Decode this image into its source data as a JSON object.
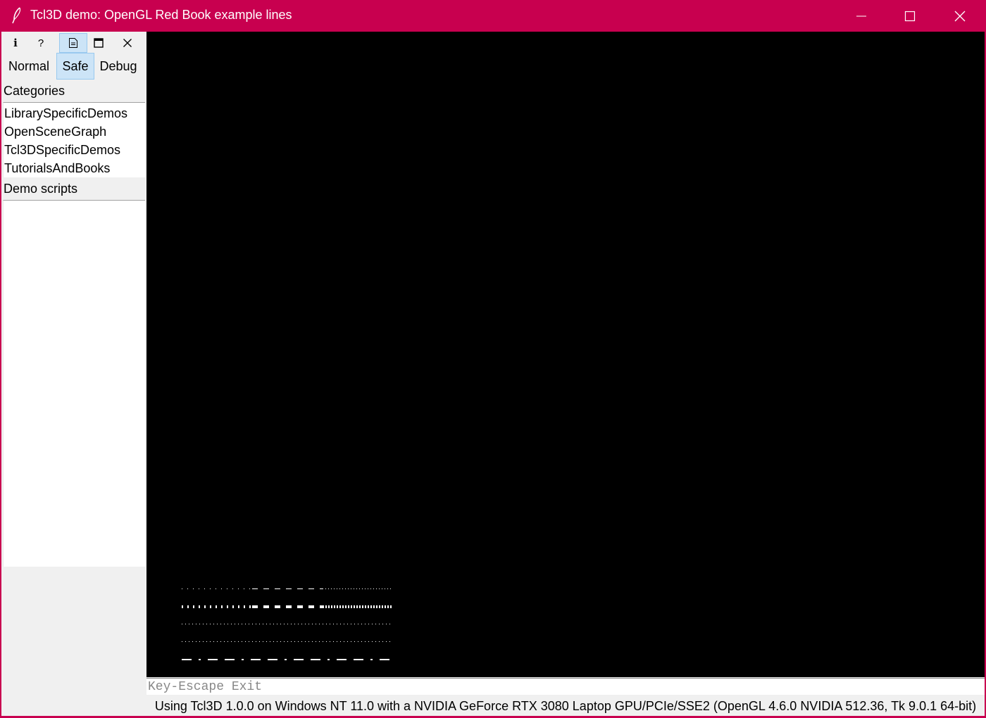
{
  "window": {
    "title": "Tcl3D demo: OpenGL Red Book example lines"
  },
  "toolbar": {
    "info_glyph": "i",
    "help_glyph": "?",
    "icons": [
      "info-icon",
      "help-icon",
      "document-icon",
      "maximize-icon",
      "close-icon"
    ]
  },
  "modes": {
    "items": [
      {
        "label": "Normal"
      },
      {
        "label": "Safe",
        "selected": true
      },
      {
        "label": "Debug"
      }
    ]
  },
  "categories": {
    "label": "Categories",
    "items": [
      {
        "label": "LibrarySpecificDemos"
      },
      {
        "label": "OpenSceneGraph"
      },
      {
        "label": "Tcl3DSpecificDemos"
      },
      {
        "label": "TutorialsAndBooks"
      }
    ]
  },
  "demo_scripts": {
    "label": "Demo scripts",
    "items": []
  },
  "canvas": {
    "background": "#000000",
    "line_color": "#ffffff"
  },
  "key_info": "Key-Escape Exit",
  "status": "Using Tcl3D 1.0.0 on Windows NT 11.0 with a NVIDIA GeForce RTX 3080 Laptop GPU/PCIe/SSE2 (OpenGL 4.6.0 NVIDIA 512.36, Tk 9.0.1 64-bit)",
  "colors": {
    "titlebar": "#c8004f",
    "selected_bg": "#cce4f7",
    "panel_bg": "#f0f0f0"
  }
}
